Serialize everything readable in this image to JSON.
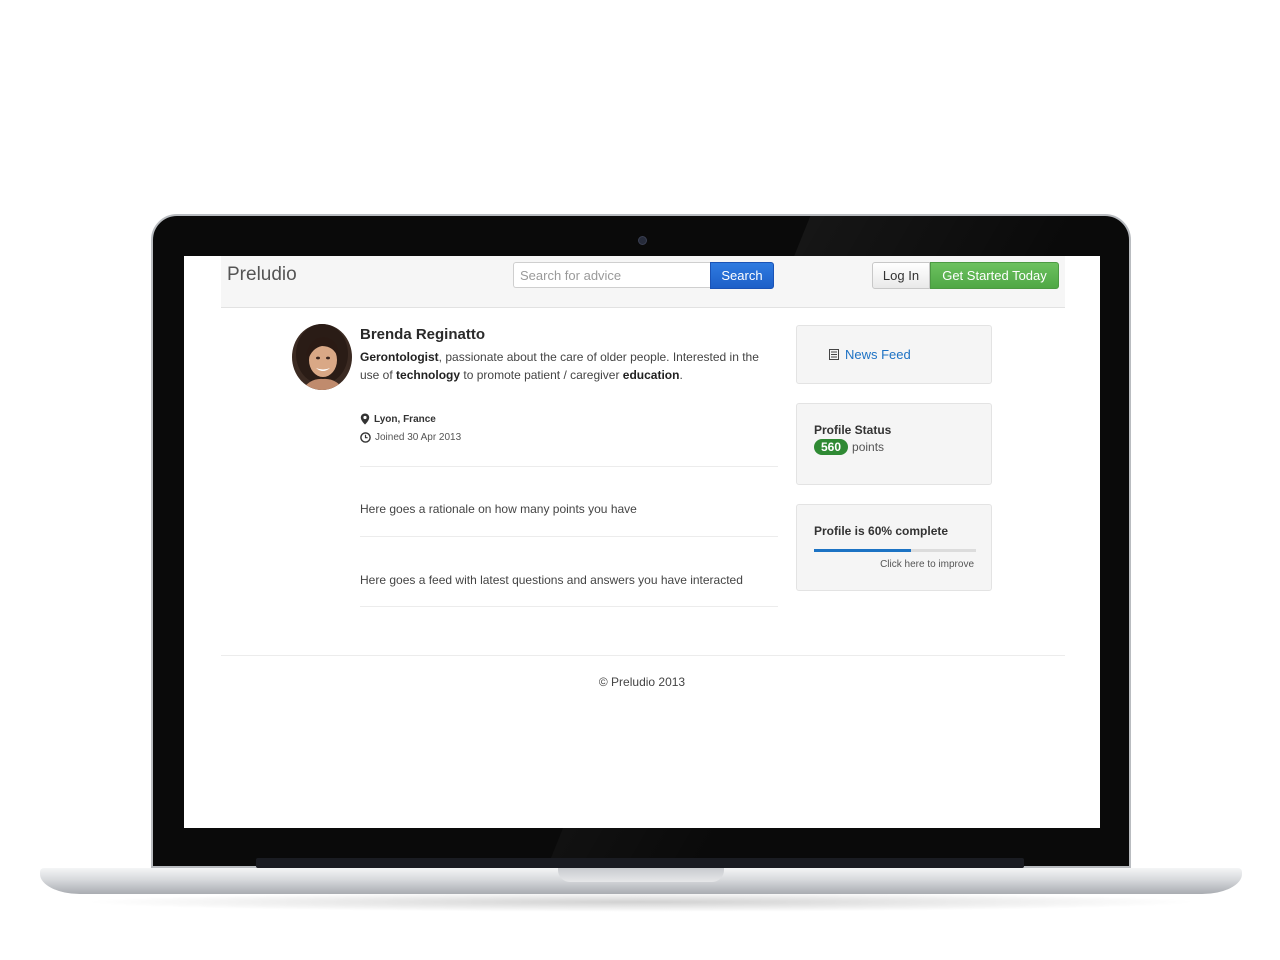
{
  "navbar": {
    "brand": "Preludio",
    "search_placeholder": "Search for advice",
    "search_value": "",
    "search_button": "Search",
    "login_button": "Log In",
    "get_started_button": "Get Started Today"
  },
  "profile": {
    "name": "Brenda Reginatto",
    "bio": {
      "part1_bold": "Gerontologist",
      "part2": ", passionate about the care of older people. Interested in the use of ",
      "part3_bold": "technology",
      "part4": " to promote patient / caregiver ",
      "part5_bold": "education",
      "part6": "."
    },
    "location": "Lyon, France",
    "joined": "Joined 30 Apr 2013",
    "location_icon": "map-marker-icon",
    "joined_icon": "clock-icon"
  },
  "feed": {
    "points_rationale": "Here goes a rationale on how many points you have",
    "activity_feed": "Here goes a feed with latest questions and answers you have interacted"
  },
  "sidebar": {
    "news_feed_label": "News Feed",
    "news_feed_icon": "list-icon",
    "profile_status_title": "Profile Status",
    "points_value": "560",
    "points_label": "points",
    "completion_title": "Profile is 60% complete",
    "completion_fraction": 0.6,
    "improve_link": "Click here to improve"
  },
  "footer": {
    "copyright": "© Preludio 2013"
  },
  "colors": {
    "accent_blue": "#1d72c4",
    "search_button": "#2f7be0",
    "start_button": "#5cb85c",
    "points_badge": "#2f8a34"
  }
}
